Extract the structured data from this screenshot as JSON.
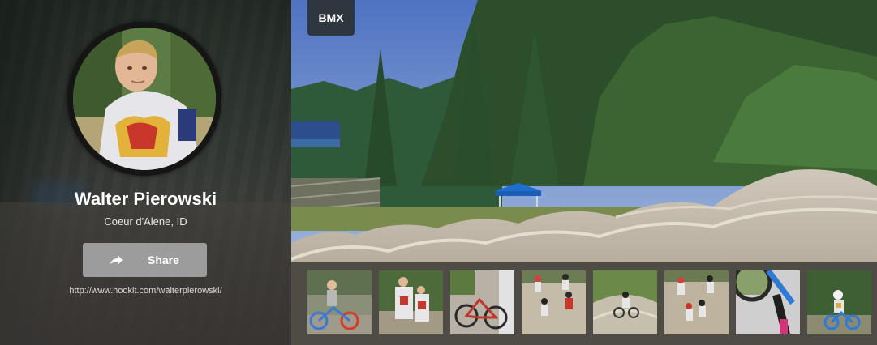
{
  "profile": {
    "name": "Walter Pierowski",
    "location": "Coeur d'Alene, ID",
    "share_label": "Share",
    "url": "http://www.hookit.com/walterpierowski/"
  },
  "hero": {
    "category_badge": "BMX"
  },
  "gallery": {
    "thumbnails": [
      {
        "name": "rider-with-bike"
      },
      {
        "name": "two-riders-jerseys"
      },
      {
        "name": "red-bmx-bike"
      },
      {
        "name": "riders-racing-track"
      },
      {
        "name": "rider-on-berm"
      },
      {
        "name": "riders-on-dirt"
      },
      {
        "name": "blue-bike-handlebar"
      },
      {
        "name": "rider-jumping"
      }
    ]
  },
  "colors": {
    "badge_bg": "#2e3640",
    "share_button_bg": "#9c9c9c",
    "sky": "#5a7cbf"
  }
}
